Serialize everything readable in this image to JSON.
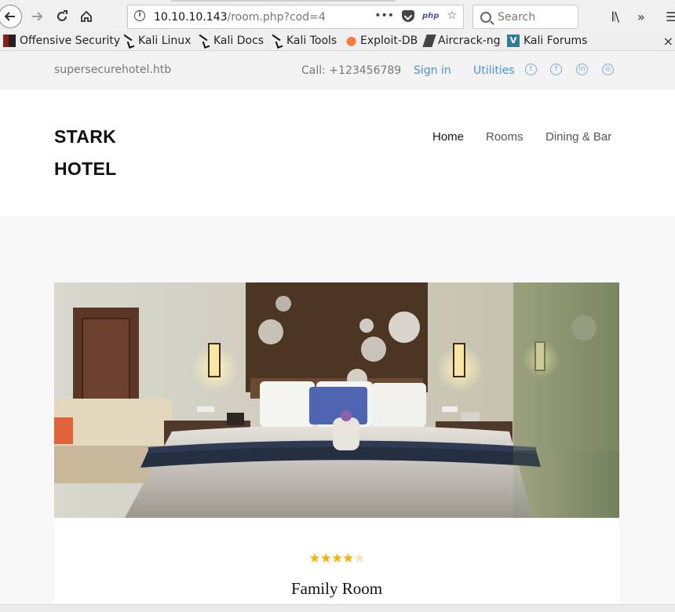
{
  "browser": {
    "url_host": "10.10.10.143",
    "url_path": "/room.php?cod=4",
    "search_placeholder": "Search",
    "php_badge": "php",
    "bookmarks": [
      {
        "label": "Offensive Security"
      },
      {
        "label": "Kali Linux"
      },
      {
        "label": "Kali Docs"
      },
      {
        "label": "Kali Tools"
      },
      {
        "label": "Exploit-DB"
      },
      {
        "label": "Aircrack-ng"
      },
      {
        "label": "Kali Forums"
      }
    ]
  },
  "topbar": {
    "site": "supersecurehotel.htb",
    "call": "Call: +123456789",
    "sign_in": "Sign in",
    "utilities": "Utilities"
  },
  "header": {
    "logo_line_1": "STARK",
    "logo_line_2": "HOTEL",
    "nav": {
      "home": "Home",
      "rooms": "Rooms",
      "dining": "Dining & Bar"
    }
  },
  "room": {
    "rating": 4,
    "rating_max": 5,
    "title": "Family Room"
  },
  "colors": {
    "accent": "#4a90e2",
    "star": "#f5b400"
  }
}
